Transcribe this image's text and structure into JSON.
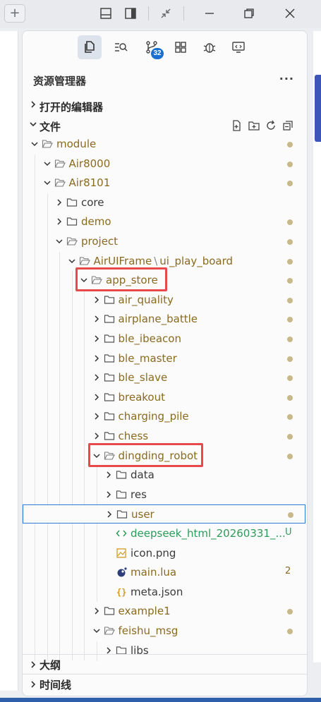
{
  "explorer": {
    "title": "资源管理器",
    "more": "···",
    "open_editors": "打开的编辑器",
    "files_section": "文件",
    "outline": "大纲",
    "timeline": "时间线"
  },
  "scm_badge": "32",
  "tree": [
    {
      "label": "module",
      "kind": "folder-open",
      "depth": 0,
      "dot": true
    },
    {
      "label": "Air8000",
      "kind": "folder-open",
      "depth": 1,
      "dot": true
    },
    {
      "label": "Air8101",
      "kind": "folder-open",
      "depth": 1,
      "dot": true
    },
    {
      "label": "core",
      "kind": "folder",
      "depth": 2,
      "dot": false
    },
    {
      "label": "demo",
      "kind": "folder",
      "depth": 2,
      "dot": true
    },
    {
      "label": "project",
      "kind": "folder-open",
      "depth": 2,
      "dot": true
    },
    {
      "label": "AirUIFrame",
      "sep": "\\",
      "label2": "ui_play_board",
      "kind": "folder-open",
      "depth": 3,
      "dot": true
    },
    {
      "label": "app_store",
      "kind": "folder-open",
      "depth": 4,
      "dot": true
    },
    {
      "label": "air_quality",
      "kind": "folder",
      "depth": 5,
      "dot": true
    },
    {
      "label": "airplane_battle",
      "kind": "folder",
      "depth": 5,
      "dot": true
    },
    {
      "label": "ble_ibeacon",
      "kind": "folder",
      "depth": 5,
      "dot": true
    },
    {
      "label": "ble_master",
      "kind": "folder",
      "depth": 5,
      "dot": true
    },
    {
      "label": "ble_slave",
      "kind": "folder",
      "depth": 5,
      "dot": true
    },
    {
      "label": "breakout",
      "kind": "folder",
      "depth": 5,
      "dot": true
    },
    {
      "label": "charging_pile",
      "kind": "folder",
      "depth": 5,
      "dot": true
    },
    {
      "label": "chess",
      "kind": "folder",
      "depth": 5,
      "dot": true
    },
    {
      "label": "dingding_robot",
      "kind": "folder-open",
      "depth": 5,
      "dot": true
    },
    {
      "label": "data",
      "kind": "folder",
      "depth": 6,
      "dot": false
    },
    {
      "label": "res",
      "kind": "folder",
      "depth": 6,
      "dot": false
    },
    {
      "label": "user",
      "kind": "folder",
      "depth": 6,
      "dot": true
    },
    {
      "label": "deepseek_html_20260331_...",
      "kind": "html",
      "depth": 6,
      "status": "U"
    },
    {
      "label": "icon.png",
      "kind": "image",
      "depth": 6
    },
    {
      "label": "main.lua",
      "kind": "lua",
      "depth": 6,
      "status": "2"
    },
    {
      "label": "meta.json",
      "kind": "json",
      "depth": 6
    },
    {
      "label": "example1",
      "kind": "folder",
      "depth": 5,
      "dot": true
    },
    {
      "label": "feishu_msg",
      "kind": "folder-open",
      "depth": 5,
      "dot": true
    },
    {
      "label": "libs",
      "kind": "folder",
      "depth": 6
    }
  ],
  "colors": {
    "accent": "#1a6fd1",
    "highlight_box": "#e8494d",
    "modified_text": "#8a6a1e",
    "untracked_text": "#2d9b59"
  }
}
